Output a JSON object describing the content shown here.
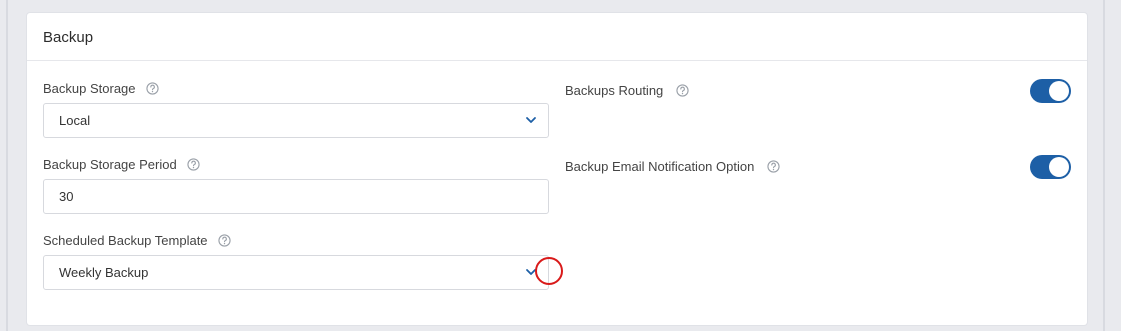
{
  "card": {
    "title": "Backup"
  },
  "fields": {
    "backup_storage": {
      "label": "Backup Storage",
      "value": "Local"
    },
    "backup_storage_period": {
      "label": "Backup Storage Period",
      "value": "30"
    },
    "scheduled_backup_template": {
      "label": "Scheduled Backup Template",
      "value": "Weekly Backup"
    },
    "backups_routing": {
      "label": "Backups Routing",
      "enabled": true
    },
    "backup_email_notification": {
      "label": "Backup Email Notification Option",
      "enabled": true
    }
  },
  "icons": {
    "help": "help-circle-icon",
    "dropdown": "chevron-down-icon"
  },
  "colors": {
    "toggle_on": "#1d5fa6",
    "chevron": "#1d5fa6",
    "highlight_circle": "#d91a1a"
  }
}
